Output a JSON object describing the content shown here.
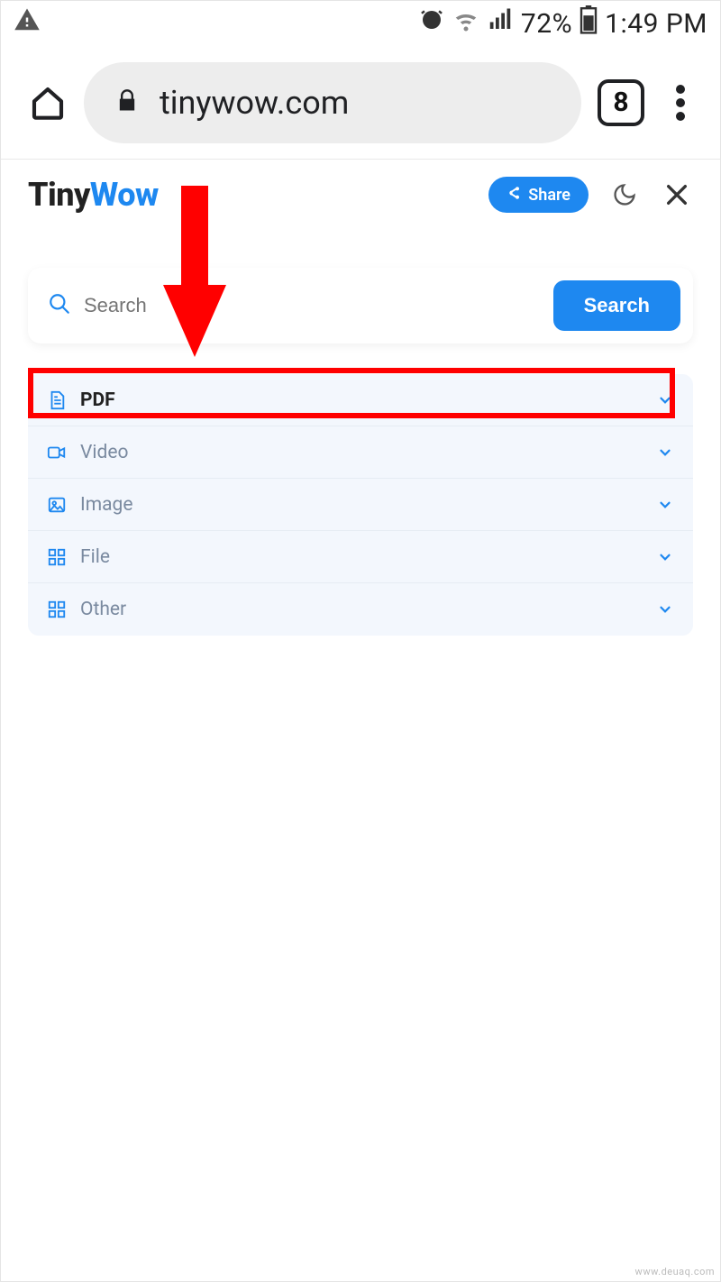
{
  "status": {
    "battery_pct": "72%",
    "time": "1:49 PM"
  },
  "browser": {
    "url": "tinywow.com",
    "tab_count": "8"
  },
  "site": {
    "logo_primary": "Tiny",
    "logo_secondary": "Wow",
    "share_label": "Share"
  },
  "search": {
    "placeholder": "Search",
    "button_label": "Search"
  },
  "categories": {
    "items": [
      {
        "label": "PDF",
        "icon": "document-icon",
        "selected": true
      },
      {
        "label": "Video",
        "icon": "video-icon",
        "selected": false
      },
      {
        "label": "Image",
        "icon": "image-icon",
        "selected": false
      },
      {
        "label": "File",
        "icon": "grid-icon",
        "selected": false
      },
      {
        "label": "Other",
        "icon": "grid-icon",
        "selected": false
      }
    ]
  },
  "watermark": "www.deuaq.com"
}
